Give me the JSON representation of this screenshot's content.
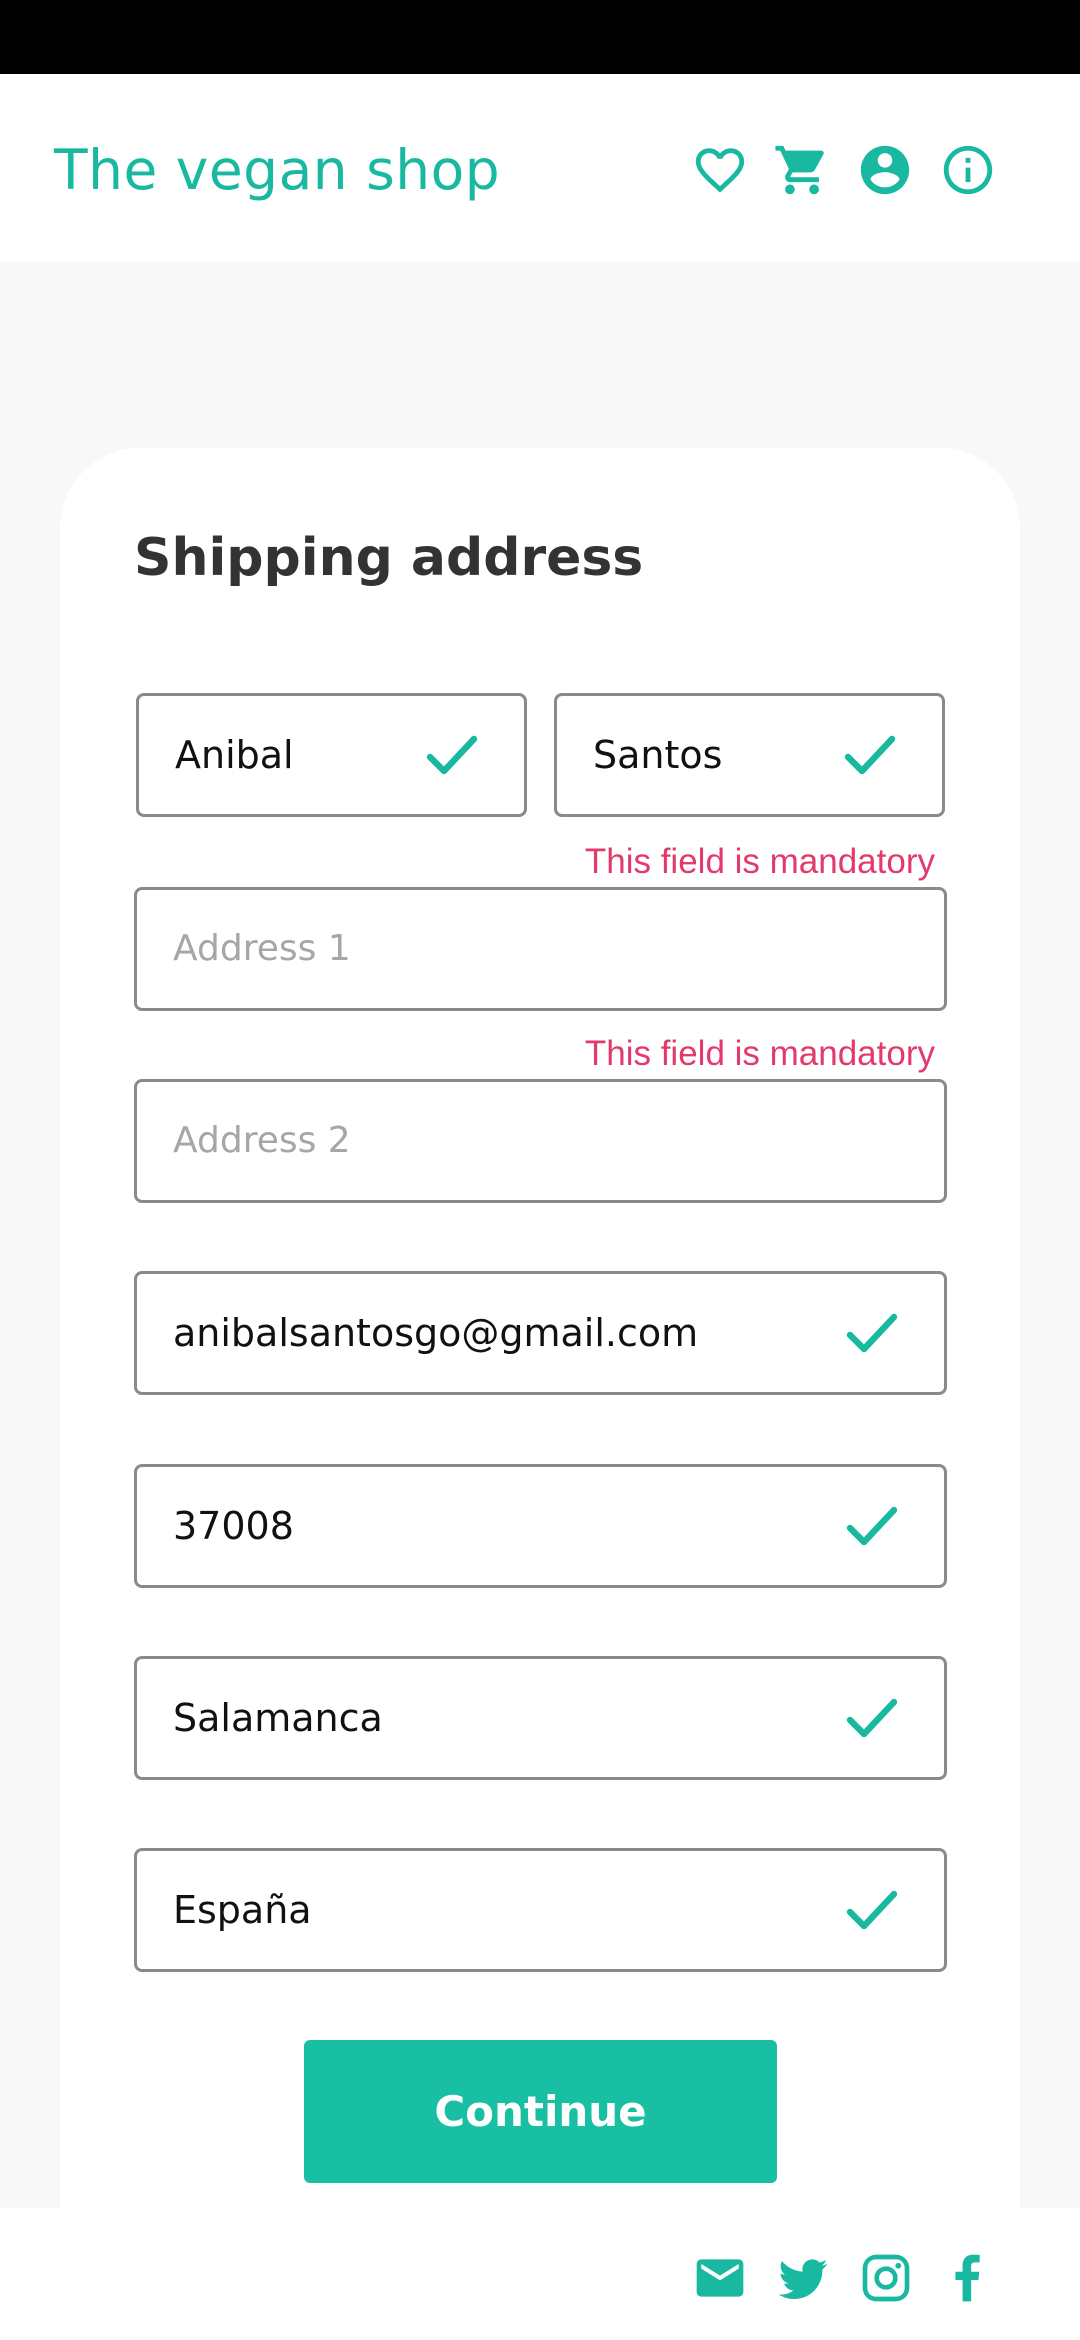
{
  "header": {
    "title": "The vegan shop",
    "icons": [
      "heart-icon",
      "cart-icon",
      "account-icon",
      "info-icon"
    ]
  },
  "form": {
    "title": "Shipping address",
    "first_name": {
      "value": "Anibal",
      "valid": true
    },
    "last_name": {
      "value": "Santos",
      "valid": true
    },
    "address1": {
      "value": "",
      "placeholder": "Address 1",
      "error": "This field is mandatory"
    },
    "address2": {
      "value": "",
      "placeholder": "Address 2",
      "error": "This field is mandatory"
    },
    "email": {
      "value": "anibalsantosgo@gmail.com",
      "valid": true
    },
    "postal_code": {
      "value": "37008",
      "valid": true
    },
    "city": {
      "value": "Salamanca",
      "valid": true
    },
    "country": {
      "value": "España",
      "valid": true
    },
    "submit_label": "Continue"
  },
  "footer": {
    "icons": [
      "mail-icon",
      "twitter-icon",
      "instagram-icon",
      "facebook-icon"
    ]
  },
  "colors": {
    "accent": "#18b9a0",
    "error": "#e23a6b",
    "border": "#8a8a8a",
    "status_bar": "#000000"
  }
}
